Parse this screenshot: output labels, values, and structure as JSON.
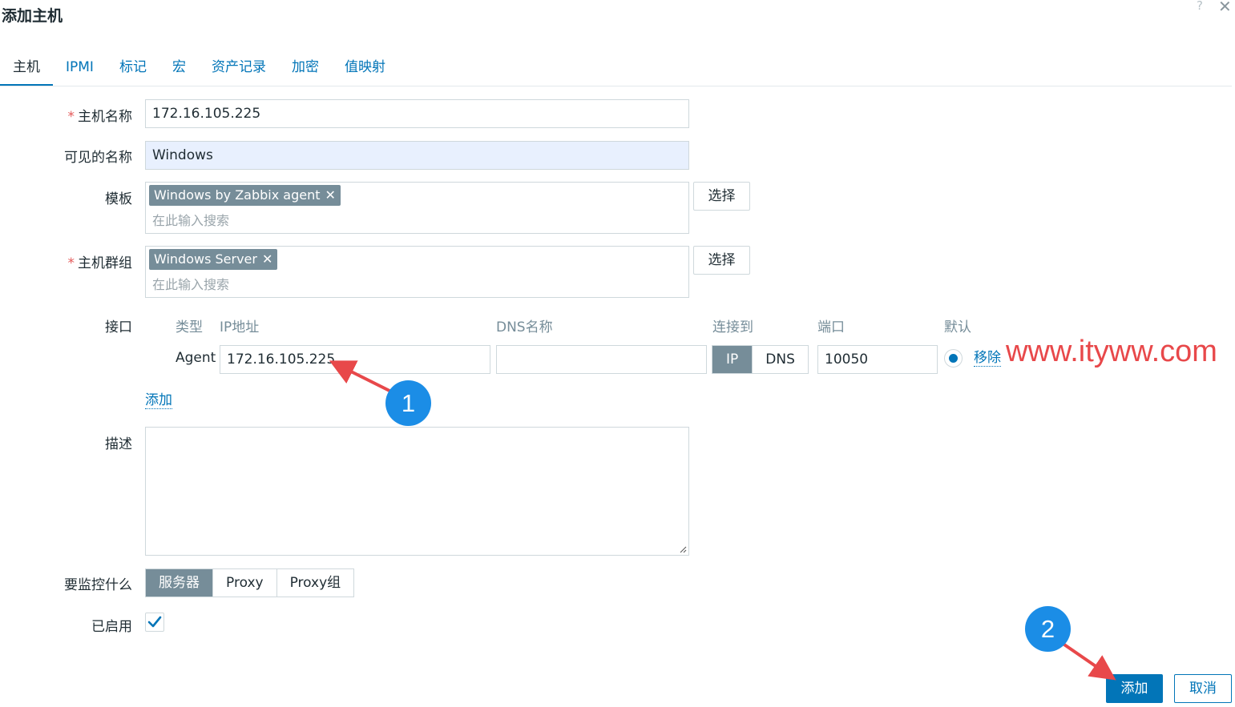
{
  "dialog": {
    "title": "添加主机",
    "help": "?",
    "close": "✕"
  },
  "tabs": [
    {
      "label": "主机"
    },
    {
      "label": "IPMI"
    },
    {
      "label": "标记"
    },
    {
      "label": "宏"
    },
    {
      "label": "资产记录"
    },
    {
      "label": "加密"
    },
    {
      "label": "值映射"
    }
  ],
  "form": {
    "required_mark": "*",
    "host_name": {
      "label": "主机名称",
      "value": "172.16.105.225"
    },
    "visible_name": {
      "label": "可见的名称",
      "value": "Windows"
    },
    "templates": {
      "label": "模板",
      "chip": "Windows by Zabbix agent",
      "placeholder": "在此输入搜索",
      "select_label": "选择"
    },
    "host_groups": {
      "label": "主机群组",
      "chip": "Windows Server",
      "placeholder": "在此输入搜索",
      "select_label": "选择"
    },
    "chip_remove": "✕",
    "interfaces": {
      "label": "接口",
      "columns": {
        "type": "类型",
        "ip": "IP地址",
        "dns": "DNS名称",
        "connect_to": "连接到",
        "port": "端口",
        "default": "默认"
      },
      "row": {
        "type": "Agent",
        "ip": "172.16.105.225",
        "dns": "",
        "connect_ip": "IP",
        "connect_dns": "DNS",
        "port": "10050",
        "remove": "移除"
      },
      "add": "添加"
    },
    "description": {
      "label": "描述",
      "value": ""
    },
    "monitored_by": {
      "label": "要监控什么",
      "options": [
        "服务器",
        "Proxy",
        "Proxy组"
      ]
    },
    "enabled": {
      "label": "已启用",
      "checked": true
    }
  },
  "footer": {
    "add": "添加",
    "cancel": "取消"
  },
  "annotations": {
    "watermark": "www.ityww.com",
    "step1": "1",
    "step2": "2"
  },
  "colors": {
    "accent": "#0275b8",
    "chip": "#768d99",
    "required": "#e45959",
    "annotation_red": "#e8484a",
    "badge_blue": "#1b8de6"
  }
}
